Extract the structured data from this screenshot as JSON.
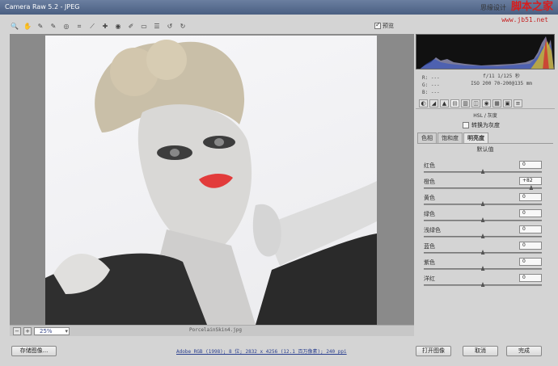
{
  "window": {
    "title": "Camera Raw 5.2 - JPEG"
  },
  "watermark": {
    "brand": "脚本之家",
    "prefix": "思缘设计",
    "url": "www.jb51.net"
  },
  "toolbar": {
    "icons": [
      "zoom-icon",
      "hand-icon",
      "white-balance-icon",
      "color-sampler-icon",
      "target-adjust-icon",
      "crop-icon",
      "straighten-icon",
      "spot-removal-icon",
      "red-eye-icon",
      "adjustment-brush-icon",
      "graduated-filter-icon",
      "preferences-icon",
      "rotate-left-icon",
      "rotate-right-icon"
    ],
    "preview_label": "预览",
    "preview_checked": true
  },
  "status": {
    "zoom": "25%",
    "filename": "PorcelainSkin4.jpg"
  },
  "info": {
    "r": "R: ---",
    "g": "G: ---",
    "b": "B: ---",
    "cam1": "f/11  1/125 秒",
    "cam2": "ISO 200  70-200@135 mm"
  },
  "panel": {
    "title": "HSL / 灰度",
    "convert_gray": "转换为灰度",
    "convert_checked": false,
    "subtabs": [
      "色相",
      "饱和度",
      "明亮度"
    ],
    "active_subtab": 2,
    "default_label": "默认值",
    "sliders": [
      {
        "label": "红色",
        "value": "0",
        "pos": 0
      },
      {
        "label": "橙色",
        "value": "+82",
        "pos": 82
      },
      {
        "label": "黄色",
        "value": "0",
        "pos": 0
      },
      {
        "label": "绿色",
        "value": "0",
        "pos": 0
      },
      {
        "label": "浅绿色",
        "value": "0",
        "pos": 0
      },
      {
        "label": "蓝色",
        "value": "0",
        "pos": 0
      },
      {
        "label": "紫色",
        "value": "0",
        "pos": 0
      },
      {
        "label": "洋红",
        "value": "0",
        "pos": 0
      }
    ]
  },
  "footer": {
    "save": "存储图像...",
    "workflow": "Adobe RGB (1998); 8 位; 2832 x 4256 (12.1 百万像素); 240 ppi",
    "open": "打开图像",
    "cancel": "取消",
    "done": "完成"
  }
}
